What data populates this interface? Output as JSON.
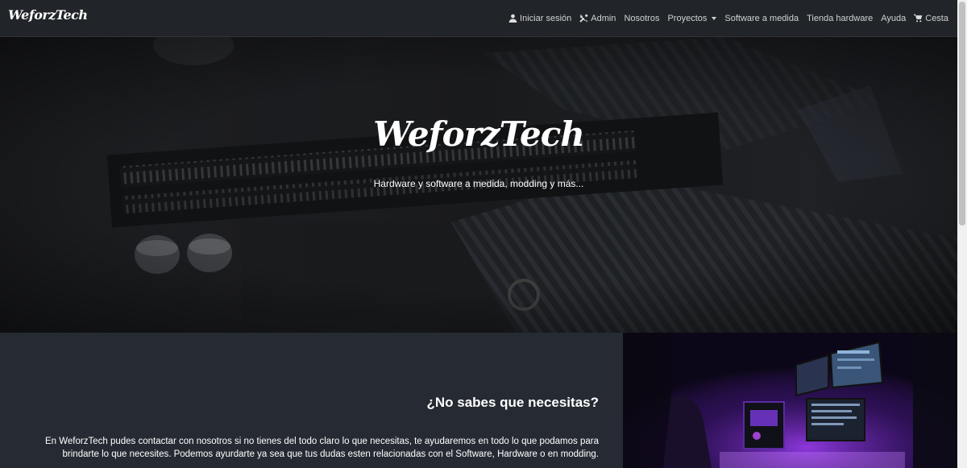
{
  "brand": {
    "name": "WeforzTech"
  },
  "nav": {
    "login": "Iniciar sesión",
    "admin": "Admin",
    "about": "Nosotros",
    "projects": "Proyectos",
    "software": "Software a medida",
    "store": "Tienda hardware",
    "help": "Ayuda",
    "cart": "Cesta"
  },
  "hero": {
    "title": "WeforzTech",
    "subtitle": "Hardware y software a medida, modding y más..."
  },
  "section": {
    "title": "¿No sabes que necesitas?",
    "text": "En WeforzTech pudes contactar con nosotros si no tienes del todo claro lo que necesitas, te ayudaremos en todo lo que podamos para brindarte lo que necesites. Podemos ayurdarte ya sea que tus dudas esten relacionadas con el Software, Hardware o en modding."
  },
  "colors": {
    "navbar": "#212529",
    "section": "#262b33",
    "accent_purple": "#7b2fd0"
  },
  "icons": [
    "user-icon",
    "tools-icon",
    "cart-icon",
    "caret-down-icon"
  ]
}
